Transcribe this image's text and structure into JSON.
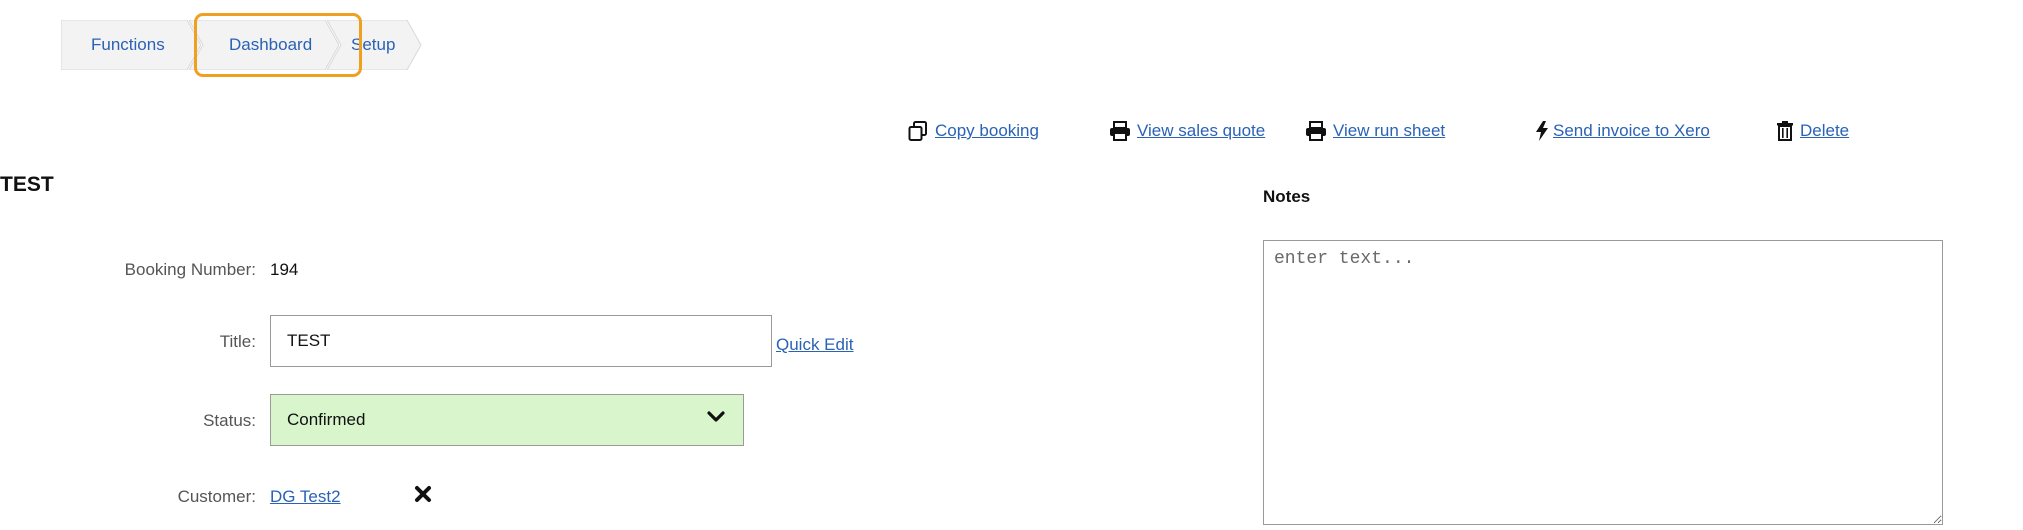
{
  "breadcrumb": {
    "items": [
      {
        "label": "Functions"
      },
      {
        "label": "Dashboard"
      },
      {
        "label": "Setup"
      }
    ]
  },
  "actions": {
    "copy_booking": "Copy booking",
    "view_sales_quote": "View sales quote",
    "view_run_sheet": "View run sheet",
    "send_invoice": "Send invoice to Xero",
    "delete": "Delete"
  },
  "page_title": "TEST",
  "booking": {
    "number_label": "Booking Number:",
    "number_value": "194",
    "title_label": "Title:",
    "title_value": "TEST",
    "quick_edit": "Quick Edit",
    "status_label": "Status:",
    "status_value": "Confirmed",
    "customer_label": "Customer:",
    "customer_value": "DG Test2"
  },
  "notes": {
    "label": "Notes",
    "placeholder": "enter text..."
  },
  "colors": {
    "link": "#2a62b5",
    "highlight": "#f0a020",
    "status_bg": "#d8f5cc",
    "tab_bg": "#f3f3f3"
  },
  "icons": [
    "copy-icon",
    "print-icon",
    "print-icon",
    "lightning-icon",
    "trash-icon",
    "chevron-down-icon",
    "close-icon"
  ]
}
